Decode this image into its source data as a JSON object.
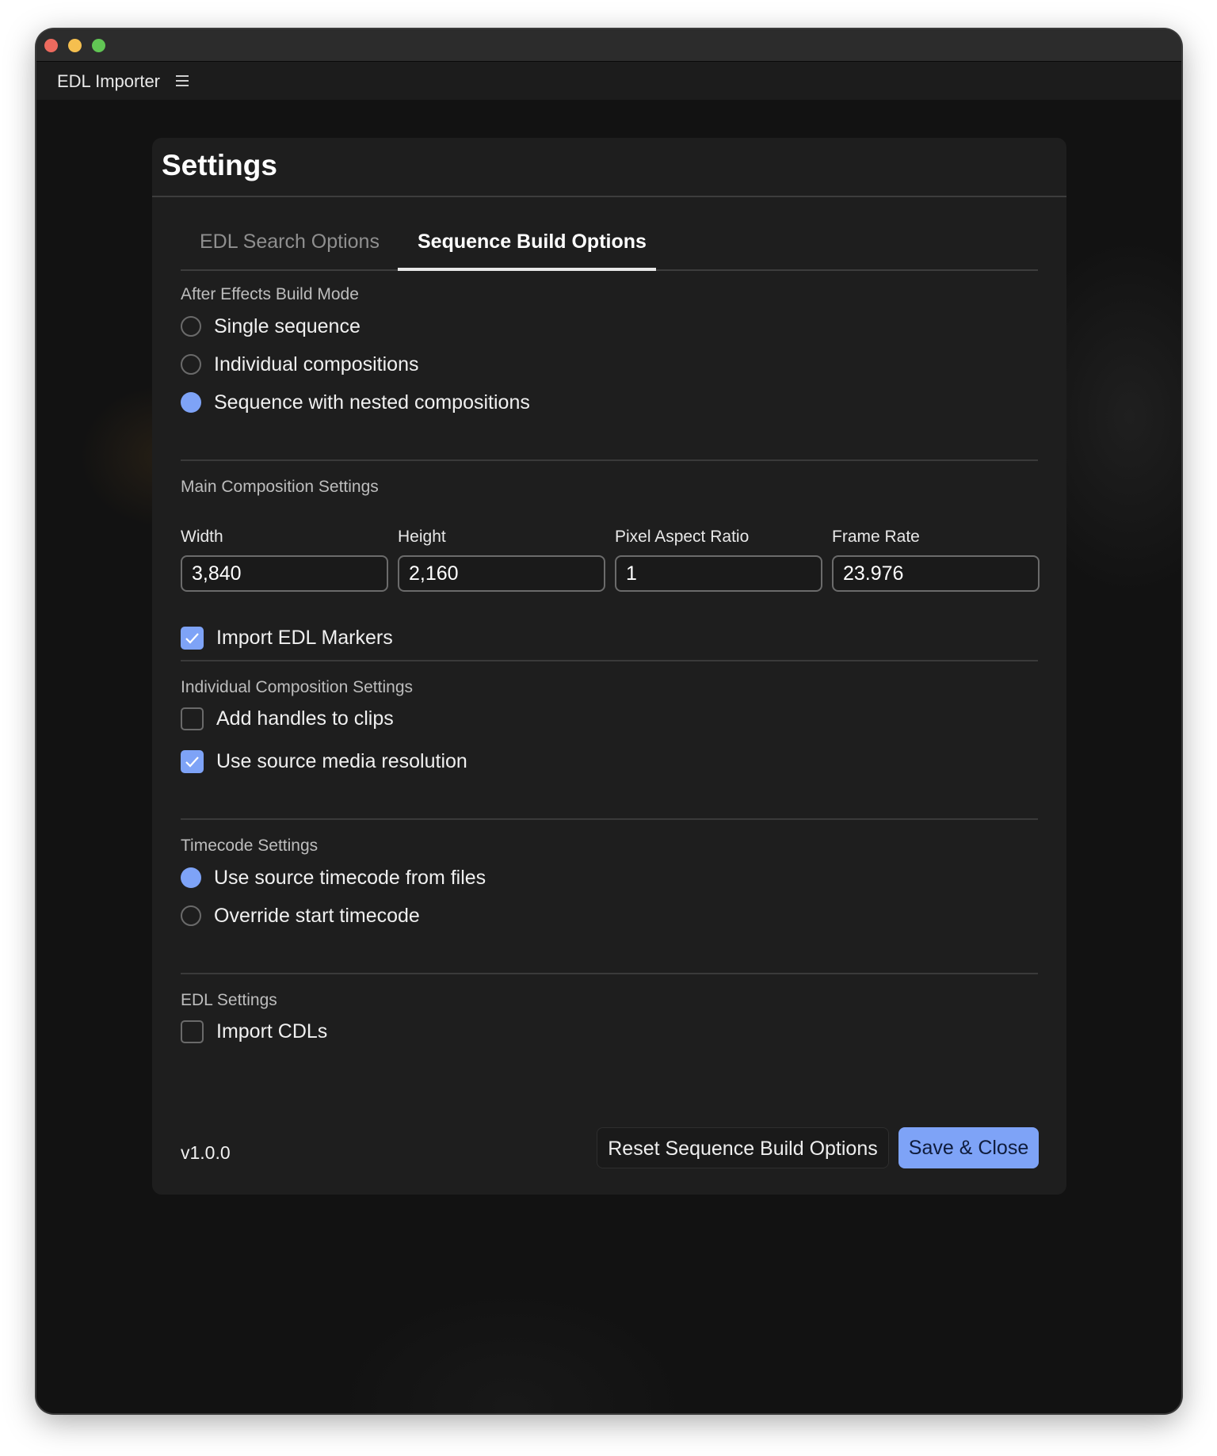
{
  "window": {
    "app_title": "EDL Importer",
    "menu_icon": "hamburger-menu-icon"
  },
  "settings": {
    "title": "Settings",
    "tabs": [
      {
        "label": "EDL Search Options",
        "active": false
      },
      {
        "label": "Sequence Build Options",
        "active": true
      }
    ],
    "build_mode": {
      "label": "After Effects Build Mode",
      "options": [
        {
          "label": "Single sequence",
          "selected": false
        },
        {
          "label": "Individual compositions",
          "selected": false
        },
        {
          "label": "Sequence with nested compositions",
          "selected": true
        }
      ]
    },
    "main_comp": {
      "label": "Main Composition Settings",
      "fields": [
        {
          "label": "Width",
          "value": "3,840"
        },
        {
          "label": "Height",
          "value": "2,160"
        },
        {
          "label": "Pixel Aspect Ratio",
          "value": "1"
        },
        {
          "label": "Frame Rate",
          "value": "23.976"
        }
      ],
      "import_markers": {
        "label": "Import EDL Markers",
        "checked": true
      }
    },
    "individual_comp": {
      "label": "Individual Composition Settings",
      "options": [
        {
          "label": "Add handles to clips",
          "checked": false
        },
        {
          "label": "Use source media resolution",
          "checked": true
        }
      ]
    },
    "timecode": {
      "label": "Timecode Settings",
      "options": [
        {
          "label": "Use source timecode from files",
          "selected": true
        },
        {
          "label": "Override start timecode",
          "selected": false
        }
      ]
    },
    "edl": {
      "label": "EDL Settings",
      "options": [
        {
          "label": "Import CDLs",
          "checked": false
        }
      ]
    },
    "footer": {
      "version": "v1.0.0",
      "reset_label": "Reset Sequence Build Options",
      "save_label": "Save & Close"
    }
  },
  "colors": {
    "accent": "#7ea3f7",
    "panel_bg": "#1e1e1e",
    "window_bg": "#121212"
  }
}
